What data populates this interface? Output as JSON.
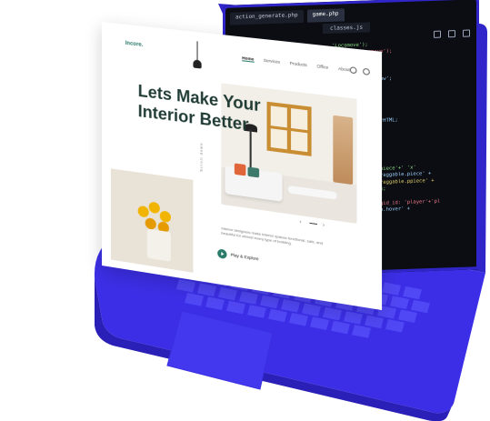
{
  "colors": {
    "laptop": "#3b2ee6",
    "laptop_dark": "#2c22c9",
    "keys": "#4c43f2",
    "code_bg": "#0b0d12",
    "brand": "#2a7a6a"
  },
  "editor": {
    "tabs": [
      "action_generate.php",
      "game.php",
      "classes.js"
    ],
    "sub_tab": "classes.js",
    "code_lines": [
      {
        "t": "'Locomove');",
        "c": "#8fe388"
      },
      {
        "t": "r.remove('locmove');",
        "c": "#f07a8a"
      },
      {
        "t": "c');",
        "c": "#e6d36b"
      },
      {
        "t": "d('locmove');",
        "c": "#8fe388"
      },
      {
        "t": "",
        "c": "#fff"
      },
      {
        "t": "move_number:  'slow';",
        "c": "#9fd3ff"
      },
      {
        "t": "",
        "c": "#fff"
      },
      {
        "t": "r:",
        "c": "#f07a8a"
      },
      {
        "t": "Change();",
        "c": "#e6d36b"
      },
      {
        "t": "nChange();",
        "c": "#8fe388"
      },
      {
        "t": "+) {",
        "c": "#ffffff"
      },
      {
        "t": "  if (i, j) ? innerHTML;",
        "c": "#9fd3ff"
      },
      {
        "t": "  if (i, j, res) {",
        "c": "#e6d36b"
      },
      {
        "t": "    res = 3;",
        "c": "#8fe388"
      },
      {
        "t": "  }",
        "c": "#ffffff"
      },
      {
        "t": "",
        "c": "#fff"
      },
      {
        "t": "piece':'x')",
        "c": "#f07a8a"
      },
      {
        "t": "' 'x'",
        "c": "#e6d36b"
      },
      {
        "t": "ng alt='+prefix=piece'+' 'x'",
        "c": "#8fe388"
      },
      {
        "t": "profile += 'no Draggable.piece' +",
        "c": "#9fd3ff"
      },
      {
        "t": "profile += 'no Draggable.ppiece' +",
        "c": "#e6d36b"
      },
      {
        "t": "r.innerHTML = res;",
        "c": "#8fe388"
      },
      {
        "t": "",
        "c": "#fff"
      },
      {
        "t": "'players'.style.gid_id: 'player'+'pl",
        "c": "#f07a8a"
      },
      {
        "t": "'player.style.tab.hover' +",
        "c": "#9fd3ff"
      }
    ]
  },
  "website": {
    "logo": "Incore.",
    "nav": [
      "Home",
      "Services",
      "Products",
      "Office",
      "About"
    ],
    "headline_line1": "Lets Make Your",
    "headline_line2": "Interior Better",
    "carousel_prev": "‹",
    "carousel_next": "›",
    "vertical_text": "Scroll down",
    "description": "Interior designers make interior spaces functional, safe, and beautiful for almost every type of building.",
    "play_label": "Play & Explore"
  }
}
